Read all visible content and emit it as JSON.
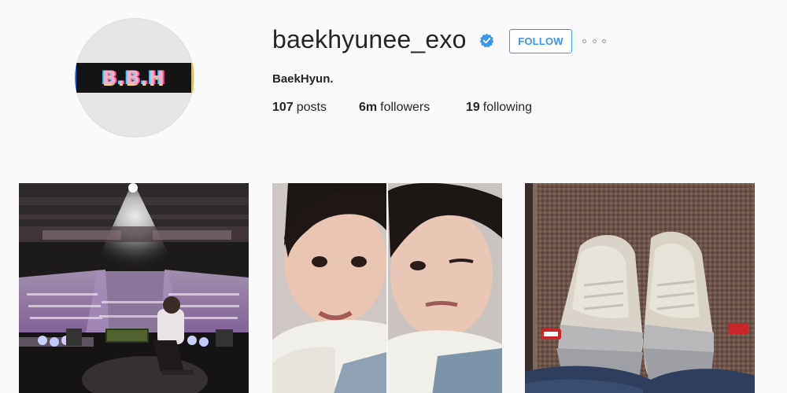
{
  "profile": {
    "username": "baekhyunee_exo",
    "verified": true,
    "follow_label": "FOLLOW",
    "full_name": "BaekHyun.",
    "avatar_text": "B.B.H",
    "stats": {
      "posts_count": "107",
      "posts_label": "posts",
      "followers_count": "6m",
      "followers_label": "followers",
      "following_count": "19",
      "following_label": "following"
    }
  },
  "icons": {
    "verified": "verified-badge-icon",
    "more": "more-options-icon"
  },
  "colors": {
    "background": "#fafafa",
    "accent": "#3897f0",
    "text": "#262626"
  }
}
